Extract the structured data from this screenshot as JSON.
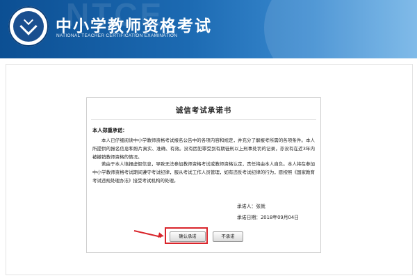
{
  "header": {
    "title": "中小学教师资格考试",
    "subtitle": "NATIONAL TEACHER CERTIFICATION EXAMINATION",
    "watermark": "NTCE",
    "logo_icon": "ntce-emblem-logo"
  },
  "dialog": {
    "title": "诚信考试承诺书",
    "greeting": "本人郑重承诺：",
    "paragraph1": "本人已仔细阅读中小学教师资格考试报名公告中的各项内容和规定，并充分了解报考所需的各项条件。本人所提供的报名信息和照片真实、准确、有效。没有因犯罪受到有期徒刑以上刑事处罚的记录，亦没有在近3年内被撤销教师资格的情况。",
    "paragraph2": "若由于本人填报虚假信息，导致无法参加教师资格考试或教师资格认定，责任将由本人自负。本人将在参加中小学教师资格考试期间遵守考试纪律，服从考试工作人员管理，如有违反考试纪律的行为，愿按照《国家教育考试违规处理办法》接受考试机构的处理。",
    "signer_label": "承诺人：张就",
    "date_label": "承诺日期：2018年09月04日",
    "confirm_button": "确认承诺",
    "decline_button": "不承诺"
  },
  "colors": {
    "header_blue": "#1c6ab2",
    "annotation_red": "#d9252b"
  }
}
